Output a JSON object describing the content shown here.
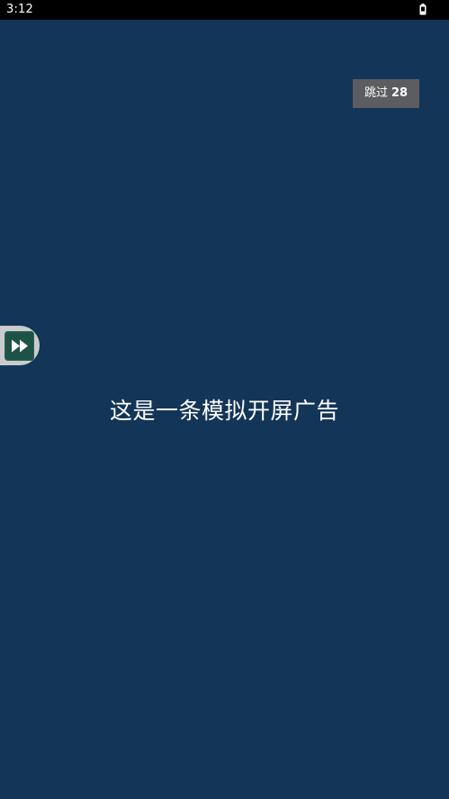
{
  "status_bar": {
    "time": "3:12",
    "battery_icon": "battery-icon"
  },
  "skip_button": {
    "label": "跳过",
    "countdown": "28"
  },
  "floating_tab": {
    "icon": "fast-forward-icon"
  },
  "ad": {
    "message": "这是一条模拟开屏广告"
  },
  "colors": {
    "background": "#133557",
    "status_bar": "#000000",
    "skip_button": "#5b5d60",
    "floating_tab_outer": "#c9cbce",
    "floating_tab_inner": "#1f5247",
    "text": "#ffffff"
  }
}
